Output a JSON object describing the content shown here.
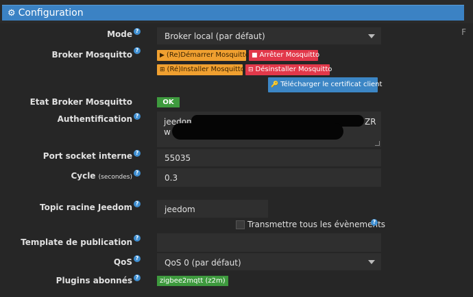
{
  "panel": {
    "title": "Configuration",
    "icon": "gears-icon",
    "right_edge_char": "F"
  },
  "fields": {
    "mode": {
      "label": "Mode",
      "value": "Broker local (par défaut)"
    },
    "broker": {
      "label": "Broker Mosquitto",
      "buttons": {
        "restart": "(Re)Démarrer Mosquitto",
        "stop": "Arrêter Mosquitto",
        "install": "(Ré)Installer Mosquitto",
        "uninstall": "Désinstaller Mosquitto",
        "download": "Télécharger le certificat client"
      }
    },
    "etat": {
      "label": "Etat Broker Mosquitto",
      "value": "OK"
    },
    "auth": {
      "label": "Authentification",
      "value_start": "jeedom:P",
      "value_end": "ZR",
      "line2_start": "w"
    },
    "port": {
      "label": "Port socket interne",
      "value": "55035"
    },
    "cycle": {
      "label": "Cycle",
      "unit": "(secondes)",
      "value": "0.3"
    },
    "topic": {
      "label": "Topic racine Jeedom",
      "value": "jeedom"
    },
    "transmit": {
      "label": "Transmettre tous les évènements",
      "checked": false
    },
    "template": {
      "label": "Template de publication",
      "value": ""
    },
    "qos": {
      "label": "QoS",
      "value": "QoS 0 (par défaut)"
    },
    "plugins": {
      "label": "Plugins abonnés",
      "tag": "zigbee2mqtt (z2m)"
    }
  },
  "colors": {
    "header": "#3b82c4",
    "warning": "#f0a030",
    "danger": "#e2384a",
    "primary": "#3c86c5",
    "success": "#3e9a3e",
    "background": "#262626",
    "field": "#2f2f2f"
  }
}
